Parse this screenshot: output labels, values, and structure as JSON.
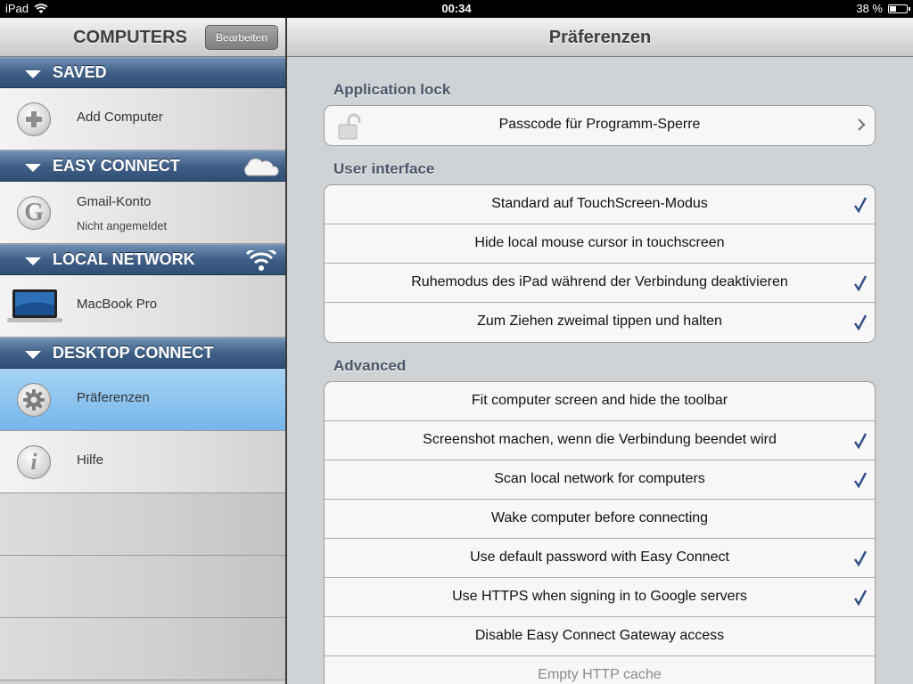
{
  "status_bar": {
    "device": "iPad",
    "time": "00:34",
    "battery": "38 %",
    "battery_level": 0.38
  },
  "sidebar": {
    "title": "COMPUTERS",
    "edit_button": "Bearbeiten",
    "sections": [
      {
        "label": "SAVED",
        "icon": "none",
        "items": [
          {
            "label": "Add Computer",
            "icon": "add-icon"
          }
        ]
      },
      {
        "label": "EASY CONNECT",
        "icon": "cloud-icon",
        "items": [
          {
            "label": "Gmail-Konto",
            "sublabel": "Nicht angemeldet",
            "icon": "google-icon"
          }
        ]
      },
      {
        "label": "LOCAL NETWORK",
        "icon": "wifi-icon",
        "items": [
          {
            "label": "MacBook Pro",
            "icon": "laptop-icon"
          }
        ]
      },
      {
        "label": "DESKTOP CONNECT",
        "icon": "none",
        "items": [
          {
            "label": "Präferenzen",
            "icon": "gear-icon",
            "selected": true
          },
          {
            "label": "Hilfe",
            "icon": "info-icon"
          }
        ]
      }
    ]
  },
  "main": {
    "title": "Präferenzen",
    "groups": [
      {
        "title": "Application lock",
        "cells": [
          {
            "label": "Passcode für Programm-Sperre",
            "accessory": "chevron",
            "icon": "lock-icon"
          }
        ]
      },
      {
        "title": "User interface",
        "cells": [
          {
            "label": "Standard auf TouchScreen-Modus",
            "checked": true
          },
          {
            "label": "Hide local mouse cursor in touchscreen",
            "checked": false
          },
          {
            "label": "Ruhemodus des iPad während der Verbindung deaktivieren",
            "checked": true
          },
          {
            "label": "Zum Ziehen zweimal tippen und halten",
            "checked": true
          }
        ]
      },
      {
        "title": "Advanced",
        "cells": [
          {
            "label": "Fit computer screen and hide the toolbar",
            "checked": false
          },
          {
            "label": "Screenshot machen, wenn die Verbindung beendet wird",
            "checked": true
          },
          {
            "label": "Scan local network for computers",
            "checked": true
          },
          {
            "label": "Wake computer before connecting",
            "checked": false
          },
          {
            "label": "Use default password with Easy Connect",
            "checked": true
          },
          {
            "label": "Use HTTPS when signing in to Google servers",
            "checked": true
          },
          {
            "label": "Disable Easy Connect Gateway access",
            "checked": false
          },
          {
            "label": "Empty HTTP cache",
            "checked": false,
            "disabled": true
          }
        ]
      }
    ]
  },
  "colors": {
    "section_header": "#3f5f86",
    "selected_row": "#8cc4ef",
    "check": "#2f4f86"
  }
}
